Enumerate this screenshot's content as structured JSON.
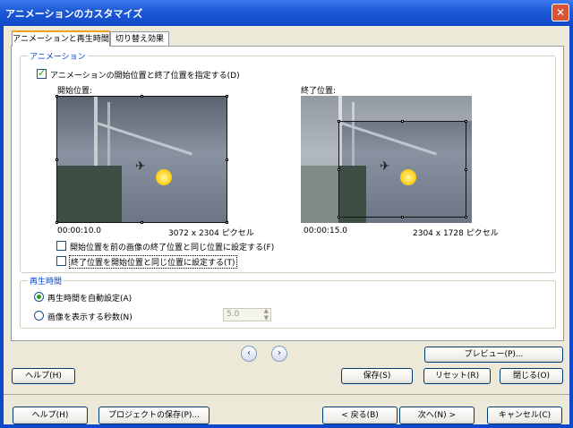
{
  "window": {
    "title": "アニメーションのカスタマイズ",
    "close_glyph": "✕"
  },
  "tabs": [
    {
      "label": "アニメーションと再生時間"
    },
    {
      "label": "切り替え効果"
    }
  ],
  "animation": {
    "group_title": "アニメーション",
    "specify_checkbox": {
      "label": "アニメーションの開始位置と終了位置を指定する(D)",
      "checked": true
    },
    "start": {
      "label": "開始位置:",
      "time": "00:00:10.0",
      "resolution": "3072 x 2304 ピクセル"
    },
    "end": {
      "label": "終了位置:",
      "time": "00:00:15.0",
      "resolution": "2304 x 1728 ピクセル"
    },
    "same_as_prev_checkbox": {
      "label": "開始位置を前の画像の終了位置と同じ位置に設定する(F)",
      "checked": false
    },
    "end_same_start_checkbox": {
      "label": "終了位置を開始位置と同じ位置に設定する(T)",
      "checked": false
    }
  },
  "playback": {
    "group_title": "再生時間",
    "auto_radio": {
      "label": "再生時間を自動設定(A)",
      "selected": true
    },
    "seconds_radio": {
      "label": "画像を表示する秒数(N)",
      "selected": false
    },
    "seconds_value": "5.0"
  },
  "nav": {
    "prev_glyph": "‹",
    "next_glyph": "›"
  },
  "buttons": {
    "preview": "プレビュー(P)...",
    "help_inner": "ヘルプ(H)",
    "save": "保存(S)",
    "reset": "リセット(R)",
    "close": "閉じる(O)",
    "help_outer": "ヘルプ(H)",
    "save_project": "プロジェクトの保存(P)...",
    "back": "< 戻る(B)",
    "next": "次へ(N) >",
    "cancel": "キャンセル(C)"
  }
}
